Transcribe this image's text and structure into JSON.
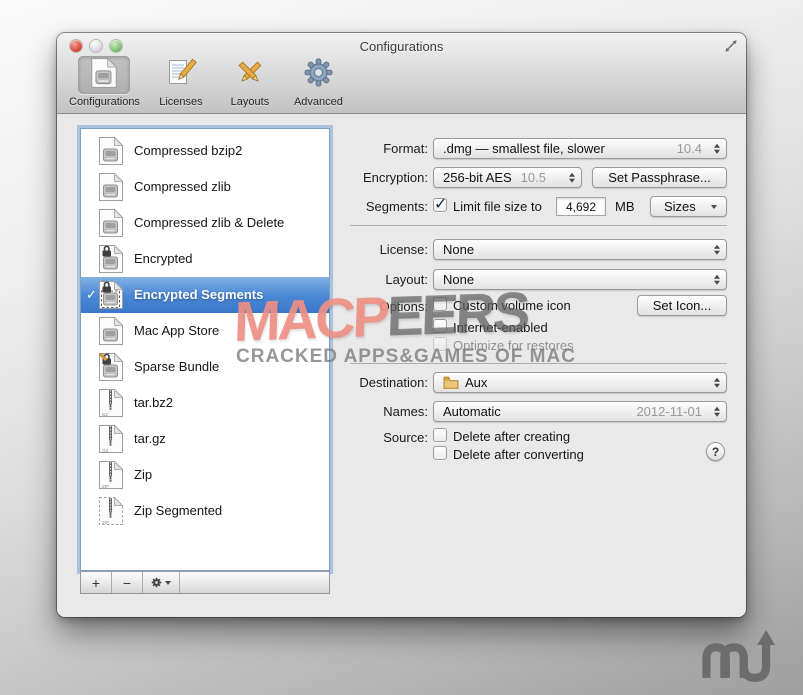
{
  "colors": {
    "selection_blue": "#3a78cc",
    "watermark_red": "#ee9085",
    "watermark_gray": "#7a7a7a",
    "traffic_red": "#dd4d42",
    "traffic_middle_gray": "#d8d8d8",
    "traffic_green": "#7fc377",
    "window_background": "#e9e9e9"
  },
  "window": {
    "title": "Configurations"
  },
  "toolbar": {
    "items": [
      {
        "label": "Configurations",
        "icon": "configurations-doc-icon",
        "selected": true
      },
      {
        "label": "Licenses",
        "icon": "licenses-paper-pencil-icon",
        "selected": false
      },
      {
        "label": "Layouts",
        "icon": "layouts-crossed-pencils-icon",
        "selected": false
      },
      {
        "label": "Advanced",
        "icon": "advanced-gear-icon",
        "selected": false
      }
    ]
  },
  "sidebar": {
    "items": [
      {
        "label": "Compressed bzip2",
        "icon": "dmg-doc",
        "selected": false,
        "checked": false
      },
      {
        "label": "Compressed zlib",
        "icon": "dmg-doc",
        "selected": false,
        "checked": false
      },
      {
        "label": "Compressed zlib & Delete",
        "icon": "dmg-doc",
        "selected": false,
        "checked": false
      },
      {
        "label": "Encrypted",
        "icon": "dmg-doc-lock",
        "selected": false,
        "checked": false
      },
      {
        "label": "Encrypted Segments",
        "icon": "dmg-doc-lock-seg",
        "selected": true,
        "checked": true
      },
      {
        "label": "Mac App Store",
        "icon": "dmg-doc",
        "selected": false,
        "checked": false
      },
      {
        "label": "Sparse Bundle",
        "icon": "dmg-doc-sparse",
        "selected": false,
        "checked": false
      },
      {
        "label": "tar.bz2",
        "icon": "zipper-doc",
        "badge": "BZ",
        "selected": false,
        "checked": false
      },
      {
        "label": "tar.gz",
        "icon": "zipper-doc",
        "badge": "GZ",
        "selected": false,
        "checked": false
      },
      {
        "label": "Zip",
        "icon": "zipper-doc",
        "badge": "ZIP",
        "selected": false,
        "checked": false
      },
      {
        "label": "Zip Segmented",
        "icon": "zipper-doc-seg",
        "badge": "ZIP",
        "selected": false,
        "checked": false
      }
    ],
    "buttons": {
      "add": "+",
      "remove": "−"
    }
  },
  "form": {
    "format": {
      "label": "Format:",
      "value": ".dmg — smallest file, slower",
      "version": "10.4"
    },
    "encryption": {
      "label": "Encryption:",
      "value": "256-bit AES",
      "version": "10.5",
      "set_passphrase": "Set Passphrase..."
    },
    "segments": {
      "label": "Segments:",
      "checkbox_label": "Limit file size to",
      "checked": true,
      "size_value": "4,692",
      "unit": "MB",
      "sizes_button": "Sizes"
    },
    "license": {
      "label": "License:",
      "value": "None"
    },
    "layout": {
      "label": "Layout:",
      "value": "None"
    },
    "options": {
      "label": "Options:",
      "set_icon": "Set Icon...",
      "checkboxes": [
        {
          "label": "Custom volume icon",
          "checked": false,
          "disabled": false
        },
        {
          "label": "Internet-enabled",
          "checked": false,
          "disabled": false
        },
        {
          "label": "Optimize for restores",
          "checked": false,
          "disabled": true
        }
      ]
    },
    "destination": {
      "label": "Destination:",
      "value": "Aux",
      "icon": "folder-icon"
    },
    "names": {
      "label": "Names:",
      "value": "Automatic",
      "date": "2012-11-01"
    },
    "source": {
      "label": "Source:",
      "checkboxes": [
        {
          "label": "Delete after creating",
          "checked": false,
          "disabled": false
        },
        {
          "label": "Delete after converting",
          "checked": false,
          "disabled": false
        }
      ]
    },
    "help": "?"
  },
  "watermark": {
    "title_red": "MACP",
    "title_gray": "EERS",
    "subtitle": "CRACKED APPS&GAMES OF MAC"
  }
}
